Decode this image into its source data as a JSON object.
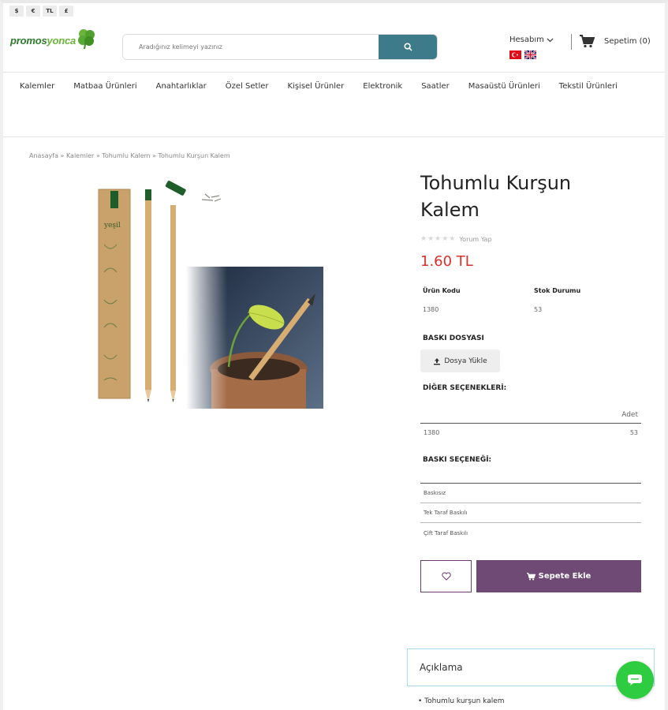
{
  "currency": [
    "$",
    "€",
    "TL",
    "£"
  ],
  "header": {
    "logo_left": "promos",
    "logo_right": "yonca",
    "search_placeholder": "Aradığınız kelimeyi yazınız",
    "account_label": "Hesabım",
    "cart_label": "Sepetim (0)"
  },
  "nav": [
    "Kalemler",
    "Matbaa Ürünleri",
    "Anahtarlıklar",
    "Özel Setler",
    "Kişisel Ürünler",
    "Elektronik",
    "Saatler",
    "Masaüstü Ürünleri",
    "Tekstil Ürünleri"
  ],
  "breadcrumb": "Anasayfa » Kalemler » Tohumlu Kalem » Tohumlu Kurşun Kalem",
  "product": {
    "title": "Tohumlu Kurşun Kalem",
    "review_link": "Yorum Yap",
    "price": "1.60 TL",
    "code_label": "Ürün Kodu",
    "code_value": "1380",
    "stock_label": "Stok Durumu",
    "stock_value": "53",
    "print_file_label": "BASKI DOSYASI",
    "upload_label": "Dosya Yükle",
    "other_options_label": "DİĞER SEÇENEKLERİ:",
    "other_options_header": "Adet",
    "other_options_rows": [
      {
        "code": "1380",
        "qty": "53"
      }
    ],
    "print_option_label": "BASKI SEÇENEĞİ:",
    "print_options": [
      "Baskısız",
      "Tek Taraf Baskılı",
      "Çift Taraf Baskılı"
    ],
    "add_to_cart": "Sepete Ekle"
  },
  "description": {
    "tab_label": "Açıklama",
    "items": [
      "• Tohumlu kurşun kalem"
    ]
  },
  "colors": {
    "accent": "#6e4a74",
    "search_button": "#3d7a8a",
    "price": "#d9302a",
    "chat": "#2ecc40"
  },
  "icons": [
    "search-icon",
    "chevron-down-icon",
    "tr-flag-icon",
    "uk-flag-icon",
    "cart-icon",
    "upload-icon",
    "heart-icon",
    "chat-icon"
  ]
}
